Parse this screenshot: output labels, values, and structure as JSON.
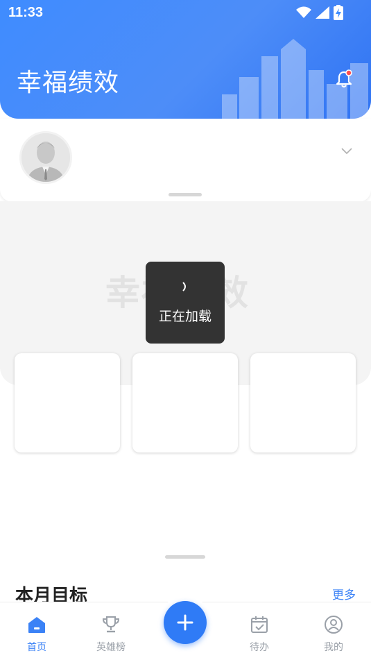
{
  "status_bar": {
    "time": "11:33",
    "icons": [
      "wifi-icon",
      "signal-icon",
      "battery-charging-icon"
    ]
  },
  "header": {
    "title": "幸福绩效",
    "notification_icon": "bell-icon",
    "has_unread_dot": true
  },
  "profile": {
    "avatar_icon": "default-avatar",
    "expand_icon": "chevron-down-icon"
  },
  "banner": {
    "watermark": "幸福绩效"
  },
  "loading_toast": {
    "text": "正在加载"
  },
  "section": {
    "title": "本月目标",
    "more_label": "更多"
  },
  "bottom_nav": {
    "items": [
      {
        "label": "首页",
        "icon": "home-icon",
        "active": true
      },
      {
        "label": "英雄榜",
        "icon": "trophy-icon",
        "active": false
      },
      {
        "label": "待办",
        "icon": "calendar-check-icon",
        "active": false
      },
      {
        "label": "我的",
        "icon": "user-circle-icon",
        "active": false
      }
    ],
    "fab_icon": "plus-icon"
  },
  "colors": {
    "primary": "#3b82f6",
    "header_gradient_start": "#3f8cff",
    "toast_bg": "#333333",
    "inactive": "#9aa0a8",
    "badge": "#ff4d4f"
  }
}
